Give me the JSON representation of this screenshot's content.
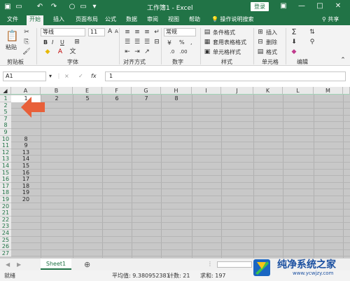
{
  "titlebar": {
    "title": "工作簿1 - Excel",
    "login": "登录",
    "icons": [
      "save-icon",
      "undo-icon",
      "redo-icon",
      "circle-icon",
      "shape-icon",
      "dropdown-icon"
    ]
  },
  "tabs": [
    "文件",
    "开始",
    "插入",
    "页面布局",
    "公式",
    "数据",
    "审阅",
    "视图",
    "帮助"
  ],
  "active_tab": "开始",
  "search_hint": "操作说明搜索",
  "share": "共享",
  "ribbon": {
    "clipboard": {
      "paste": "粘贴",
      "label": "剪贴板"
    },
    "font": {
      "name": "等线",
      "size": "11",
      "label": "字体",
      "bold": "B",
      "italic": "I",
      "underline": "U",
      "grow": "A",
      "shrink": "A"
    },
    "alignment": {
      "label": "对齐方式"
    },
    "number": {
      "format": "常规",
      "percent": "%",
      "comma": ",",
      "label": "数字"
    },
    "styles": {
      "conditional": "条件格式",
      "table": "套用表格格式",
      "cell": "单元格样式",
      "label": "样式"
    },
    "cells": {
      "insert": "插入",
      "delete": "删除",
      "format": "格式",
      "label": "单元格"
    },
    "editing": {
      "label": "编辑"
    }
  },
  "formula_bar": {
    "name_box": "A1",
    "formula": "1",
    "cancel": "×",
    "enter": "✓",
    "fx": "fx"
  },
  "columns": [
    "A",
    "B",
    "E",
    "F",
    "G",
    "H",
    "I",
    "J",
    "K",
    "L",
    "M"
  ],
  "rows": [
    "1",
    "2",
    "5",
    "7",
    "8",
    "9",
    "10",
    "11",
    "12",
    "13",
    "14",
    "15",
    "16",
    "17",
    "18",
    "19",
    "20",
    "21",
    "22",
    "23",
    "24",
    "25",
    "26",
    "27"
  ],
  "cells": {
    "row1": {
      "A": "1",
      "B": "2",
      "E": "5",
      "F": "6",
      "G": "7",
      "H": "8"
    },
    "col_a": [
      "",
      "",
      "",
      "",
      "",
      "",
      "8",
      "9",
      "13",
      "14",
      "15",
      "16",
      "17",
      "18",
      "19",
      "20"
    ]
  },
  "sheet": {
    "name": "Sheet1",
    "add": "⊕"
  },
  "status": {
    "ready": "就绪",
    "average": "平均值: 9.380952381",
    "count": "计数: 21",
    "sum": "求和: 197"
  },
  "watermark": {
    "brand": "纯净系统之家",
    "url": "www.ycwjzy.com"
  },
  "colors": {
    "excel_green": "#217346",
    "arrow": "#e8603a",
    "grid_gray": "#c8c8c8"
  }
}
